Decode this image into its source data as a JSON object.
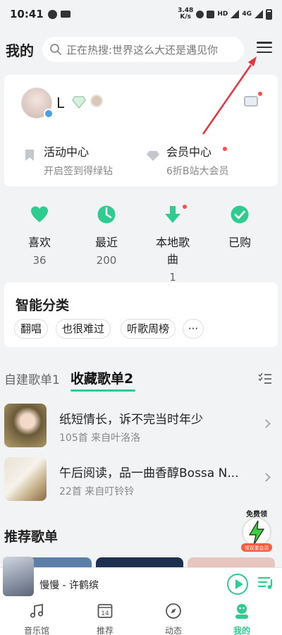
{
  "statusbar": {
    "time": "10:41",
    "speed_top": "3.48",
    "speed_bottom": "K/s",
    "network": "HD",
    "network2": "4G"
  },
  "header": {
    "title": "我的",
    "search_placeholder": "正在热搜:世界这么大还是遇见你"
  },
  "profile": {
    "username": "L",
    "activity": {
      "label": "活动中心",
      "sub": "开启签到得绿钻"
    },
    "vip": {
      "label": "会员中心",
      "sub": "6折B站大会员"
    }
  },
  "quick": [
    {
      "label": "喜欢",
      "count": "36",
      "icon": "heart-icon"
    },
    {
      "label": "最近",
      "count": "200",
      "icon": "clock-icon"
    },
    {
      "label": "本地歌曲",
      "count": "1",
      "icon": "download-icon"
    },
    {
      "label": "已购",
      "count": "",
      "icon": "check-icon"
    }
  ],
  "categories": {
    "title": "智能分类",
    "chips": [
      "翻唱",
      "也很难过",
      "听歌周榜",
      "···"
    ]
  },
  "playlist_tabs": {
    "created": "自建歌单1",
    "collected": "收藏歌单2"
  },
  "playlists": [
    {
      "title": "纸短情长，诉不完当时年少",
      "sub": "105首 来自叶洛洛"
    },
    {
      "title": "午后阅读，品一曲香醇Bossa N...",
      "sub": "22首 来自叮铃铃"
    }
  ],
  "recommend": {
    "title": "推荐歌单"
  },
  "promo": {
    "line1": "免费领",
    "line2": "领双重会员"
  },
  "player": {
    "song": "慢慢 - 许鹤缤"
  },
  "tabbar": [
    {
      "label": "音乐馆",
      "icon": "music-note-icon"
    },
    {
      "label": "推荐",
      "icon": "calendar-icon",
      "icon_text": "14"
    },
    {
      "label": "动态",
      "icon": "compass-icon"
    },
    {
      "label": "我的",
      "icon": "profile-icon"
    }
  ],
  "colors": {
    "accent": "#2fcc8f",
    "alert": "#ff4d4f",
    "annotation": "#e8333a"
  }
}
